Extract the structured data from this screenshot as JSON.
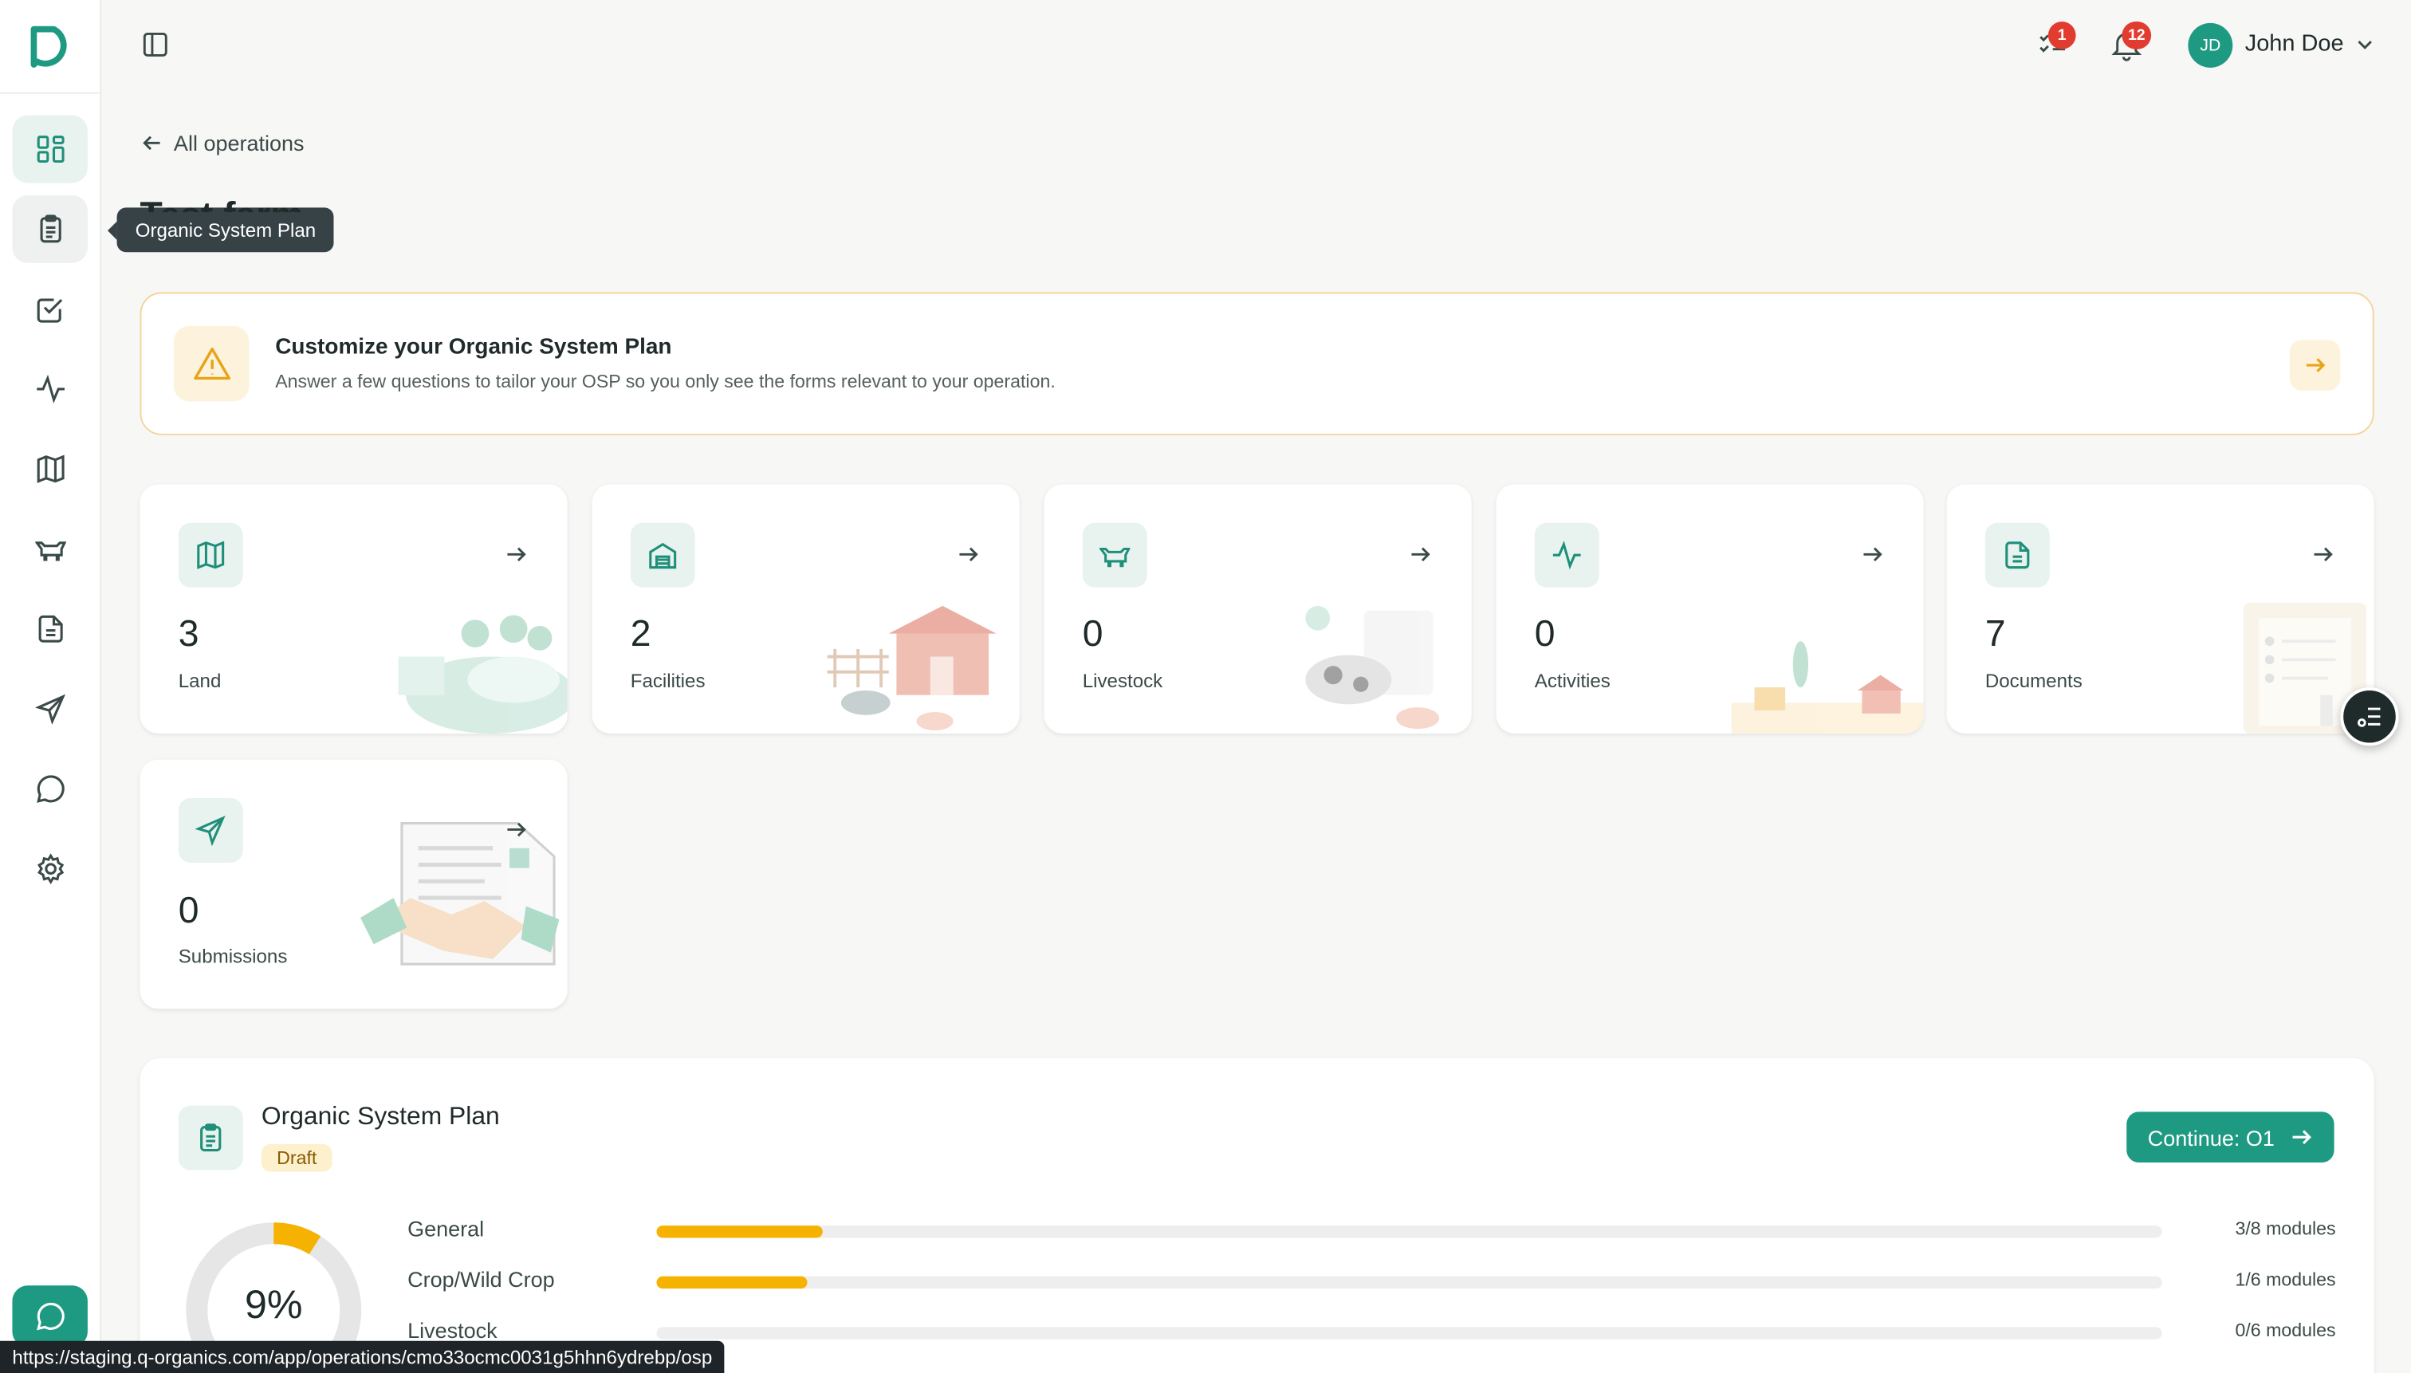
{
  "sidebar": {
    "items": [
      {
        "name": "dashboard",
        "icon": "dashboard-icon"
      },
      {
        "name": "organic-system-plan",
        "icon": "clipboard-icon"
      },
      {
        "name": "tasks",
        "icon": "checkbox-icon"
      },
      {
        "name": "activities",
        "icon": "activity-icon"
      },
      {
        "name": "land",
        "icon": "map-icon"
      },
      {
        "name": "livestock",
        "icon": "cow-icon"
      },
      {
        "name": "documents",
        "icon": "document-icon"
      },
      {
        "name": "submissions",
        "icon": "send-icon"
      },
      {
        "name": "messages",
        "icon": "message-icon"
      },
      {
        "name": "settings",
        "icon": "gear-icon"
      }
    ],
    "tooltip": "Organic System Plan"
  },
  "header": {
    "task_badge": "1",
    "notification_badge": "12",
    "avatar_initials": "JD",
    "user_name": "John Doe"
  },
  "back_link": "All operations",
  "page_title": "Test farm",
  "banner": {
    "title": "Customize your Organic System Plan",
    "subtitle": "Answer a few questions to tailor your OSP so you only see the forms relevant to your operation."
  },
  "stats": [
    {
      "count": "3",
      "label": "Land",
      "icon": "map-icon"
    },
    {
      "count": "2",
      "label": "Facilities",
      "icon": "warehouse-icon"
    },
    {
      "count": "0",
      "label": "Livestock",
      "icon": "cow-icon"
    },
    {
      "count": "0",
      "label": "Activities",
      "icon": "activity-icon"
    },
    {
      "count": "7",
      "label": "Documents",
      "icon": "document-icon"
    },
    {
      "count": "0",
      "label": "Submissions",
      "icon": "send-icon"
    }
  ],
  "osp": {
    "title": "Organic System Plan",
    "status": "Draft",
    "continue_label": "Continue: O1",
    "percent_label": "9%",
    "percent": 9,
    "rows": [
      {
        "label": "General",
        "count": "3/8 modules",
        "progress": 0.11
      },
      {
        "label": "Crop/Wild Crop",
        "count": "1/6 modules",
        "progress": 0.1
      },
      {
        "label": "Livestock",
        "count": "0/6 modules",
        "progress": 0
      }
    ]
  },
  "status_url": "https://staging.q-organics.com/app/operations/cmo33ocmc0031g5hhn6ydrebp/osp",
  "colors": {
    "accent": "#1f9a82",
    "warning": "#f5b200",
    "badge": "#e23b2f"
  }
}
